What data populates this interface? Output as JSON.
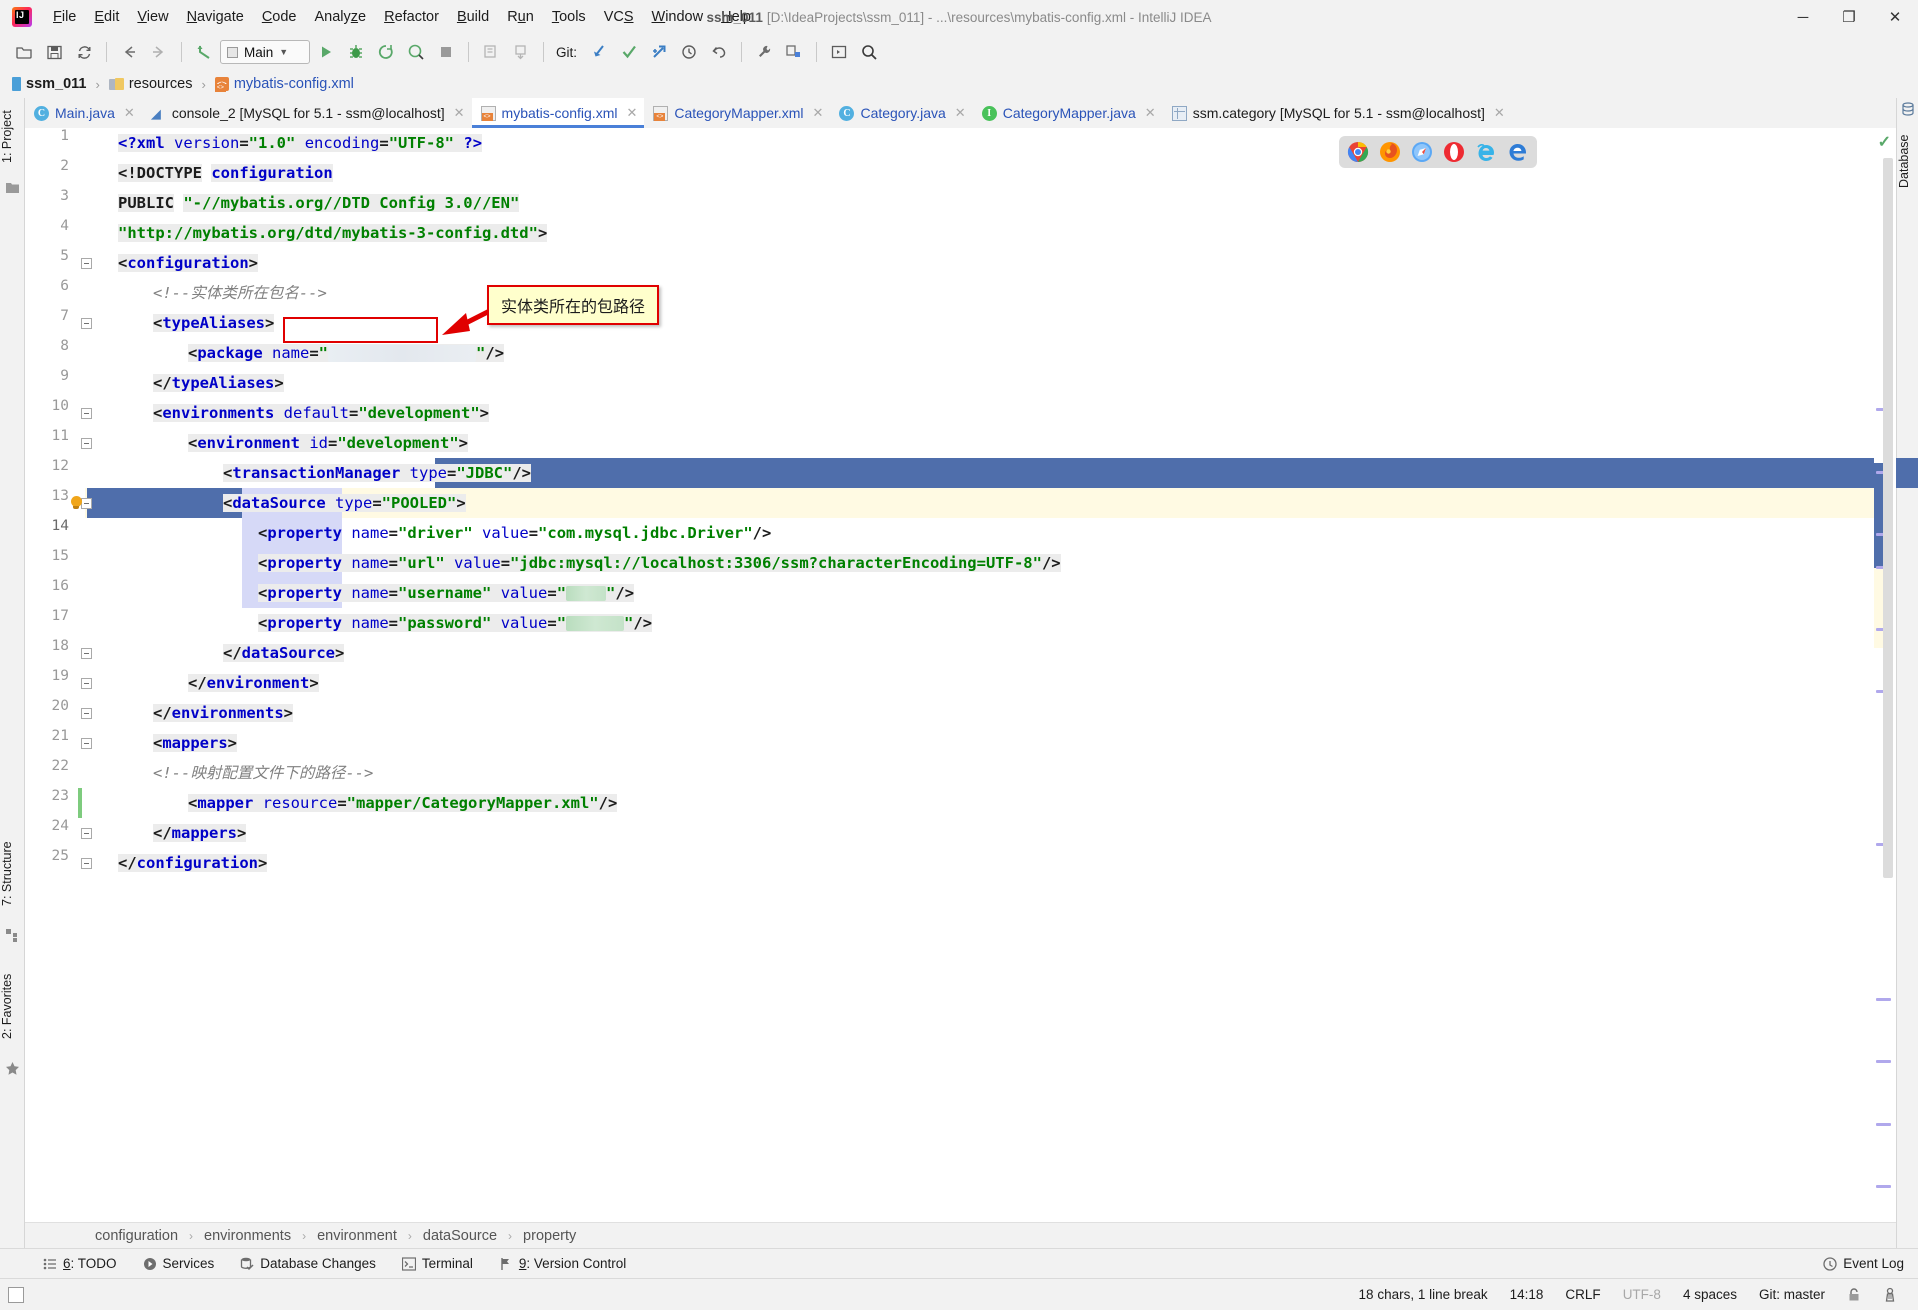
{
  "window": {
    "title_project": "ssm_011",
    "title_rest": "[D:\\IdeaProjects\\ssm_011] - ...\\resources\\mybatis-config.xml - IntelliJ IDEA",
    "minimize": "─",
    "maximize": "❐",
    "close": "✕"
  },
  "menubar": {
    "items": [
      {
        "label": "File"
      },
      {
        "label": "Edit"
      },
      {
        "label": "View"
      },
      {
        "label": "Navigate"
      },
      {
        "label": "Code"
      },
      {
        "label": "Analyze"
      },
      {
        "label": "Refactor"
      },
      {
        "label": "Build"
      },
      {
        "label": "Run"
      },
      {
        "label": "Tools"
      },
      {
        "label": "VCS"
      },
      {
        "label": "Window"
      },
      {
        "label": "Help"
      }
    ]
  },
  "toolbar": {
    "run_config": "Main",
    "git_label": "Git:",
    "icons": [
      "open-project-icon",
      "save-all-icon",
      "sync-refresh-icon",
      "back-arrow-icon",
      "forward-arrow-icon",
      "undo-jump-icon",
      "run-icon",
      "debug-icon",
      "run-coverage-icon",
      "profile-icon",
      "stop-icon",
      "build-project-icon",
      "build-module-icon",
      "git-update-icon",
      "git-commit-icon",
      "git-push-icon",
      "git-history-icon",
      "git-revert-icon",
      "settings-wrench-icon",
      "project-structure-icon",
      "run-anything-icon",
      "search-everywhere-icon"
    ]
  },
  "navbar": {
    "items": [
      {
        "label": "ssm_011",
        "icon": "module-icon",
        "kind": "proj"
      },
      {
        "label": "resources",
        "icon": "resources-folder-icon",
        "kind": "folder"
      },
      {
        "label": "mybatis-config.xml",
        "icon": "xml-file-icon",
        "kind": "file"
      }
    ],
    "separator": "›"
  },
  "left_stripe": {
    "tabs": [
      {
        "label": "1: Project",
        "icon": "project-folder-icon"
      },
      {
        "label": "7: Structure",
        "icon": "structure-icon"
      },
      {
        "label": "2: Favorites",
        "icon": "star-icon"
      }
    ]
  },
  "right_stripe": {
    "tabs": [
      {
        "label": "Database",
        "icon": "database-icon"
      }
    ]
  },
  "editor_tabs": [
    {
      "label": "Main.java",
      "icon": "java-class-icon",
      "active": false,
      "close": "✕"
    },
    {
      "label": "console_2 [MySQL for 5.1 - ssm@localhost]",
      "icon": "console-icon",
      "active": false,
      "close": "✕"
    },
    {
      "label": "mybatis-config.xml",
      "icon": "xml-file-icon",
      "active": true,
      "close": "✕"
    },
    {
      "label": "CategoryMapper.xml",
      "icon": "xml-file-icon",
      "active": false,
      "close": "✕"
    },
    {
      "label": "Category.java",
      "icon": "java-class-icon",
      "active": false,
      "close": "✕"
    },
    {
      "label": "CategoryMapper.java",
      "icon": "java-interface-icon",
      "active": false,
      "close": "✕"
    },
    {
      "label": "ssm.category [MySQL for 5.1 - ssm@localhost]",
      "icon": "db-table-icon",
      "active": false,
      "close": "✕"
    }
  ],
  "editor": {
    "line_numbers": [
      "1",
      "2",
      "3",
      "4",
      "5",
      "6",
      "7",
      "8",
      "9",
      "10",
      "11",
      "12",
      "13",
      "14",
      "15",
      "16",
      "17",
      "18",
      "19",
      "20",
      "21",
      "22",
      "23",
      "24",
      "25"
    ],
    "lines": [
      {
        "n": 1,
        "indent": 0,
        "html": "<span class=\"hl-id\"><span class=\"tk-pi\">&lt;?</span><span class=\"tk-tag\">xml </span><span class=\"tk-attr\">version</span><span class=\"tk-punc\">=</span><span class=\"tk-val\">\"1.0\"</span><span class=\"tk-punc\"> </span><span class=\"tk-attr\">encoding</span><span class=\"tk-punc\">=</span><span class=\"tk-val\">\"UTF-8\"</span><span class=\"tk-punc\"> </span><span class=\"tk-pi\">?&gt;</span></span>"
      },
      {
        "n": 2,
        "indent": 0,
        "html": "<span class=\"hl-id\"><span class=\"tk-dtd\">&lt;!DOCTYPE</span></span> <span class=\"hl-id\"><span class=\"tk-tag\">configuration</span></span>"
      },
      {
        "n": 3,
        "indent": 0,
        "html": "<span class=\"hl-id\"><span class=\"tk-dtd\">PUBLIC</span></span> <span class=\"hl-id\"><span class=\"tk-val\">\"-//mybatis.org//DTD Config 3.0//EN\"</span></span>"
      },
      {
        "n": 4,
        "indent": 0,
        "html": "<span class=\"hl-id\"><span class=\"tk-val\">\"http://mybatis.org/dtd/mybatis-3-config.dtd\"</span><span class=\"tk-punc\">&gt;</span></span>"
      },
      {
        "n": 5,
        "indent": 0,
        "html": "<span class=\"hl-id\"><span class=\"tk-punc\">&lt;</span><span class=\"tk-tag\">configuration</span><span class=\"tk-punc\">&gt;</span></span>"
      },
      {
        "n": 6,
        "indent": 1,
        "html": "<span class=\"tk-cmt\">&lt;!--实体类所在包名--&gt;</span>"
      },
      {
        "n": 7,
        "indent": 1,
        "html": "<span class=\"hl-id\"><span class=\"tk-punc\">&lt;</span><span class=\"tk-tag\">typeAliases</span><span class=\"tk-punc\">&gt;</span></span>"
      },
      {
        "n": 8,
        "indent": 2,
        "html": "<span class=\"hl-id\"><span class=\"tk-punc\">&lt;</span><span class=\"tk-tag\">package </span><span class=\"tk-attr\">name</span><span class=\"tk-punc\">=</span><span class=\"tk-val\">\"</span><span class=\"redacted\" style=\"width:148px;height:17px;background:linear-gradient(90deg,#e9eef3,#e3e8ee,#eaeef2)\"></span><span class=\"tk-val\">\"</span><span class=\"tk-punc\">/&gt;</span></span>"
      },
      {
        "n": 9,
        "indent": 1,
        "html": "<span class=\"hl-id\"><span class=\"tk-punc\">&lt;/</span><span class=\"tk-tag\">typeAliases</span><span class=\"tk-punc\">&gt;</span></span>"
      },
      {
        "n": 10,
        "indent": 1,
        "html": "<span class=\"hl-id\"><span class=\"tk-punc\">&lt;</span><span class=\"tk-tag\">environments </span><span class=\"tk-attr\">default</span><span class=\"tk-punc\">=</span><span class=\"tk-val\">\"development\"</span><span class=\"tk-punc\">&gt;</span></span>"
      },
      {
        "n": 11,
        "indent": 2,
        "html": "<span class=\"hl-id\"><span class=\"tk-punc\">&lt;</span><span class=\"tk-tag\">environment </span><span class=\"tk-attr\">id</span><span class=\"tk-punc\">=</span><span class=\"tk-val\">\"development\"</span><span class=\"tk-punc\">&gt;</span></span>"
      },
      {
        "n": 12,
        "indent": 3,
        "html": "<span class=\"hl-id\"><span class=\"tk-punc\">&lt;</span><span class=\"tk-tag\">transactionManager </span><span class=\"tk-attr\">type</span><span class=\"tk-punc\">=</span><span class=\"tk-val\">\"JDBC\"</span><span class=\"tk-punc\">/&gt;</span></span>"
      },
      {
        "n": 13,
        "indent": 3,
        "html": "<span class=\"hl-id\"><span class=\"tk-punc\">&lt;</span><span class=\"tk-tag\">dataSource </span><span class=\"tk-attr\">type</span><span class=\"tk-punc\">=</span><span class=\"tk-val\">\"POOLED\"</span><span class=\"tk-punc\">&gt;</span></span>"
      },
      {
        "n": 14,
        "indent": 4,
        "html": "<span class=\"tk-punc\">&lt;</span><span class=\"tk-tag\">property </span><span class=\"tk-attr\">name</span><span class=\"tk-punc\">=</span><span class=\"tk-val\">\"driver\"</span><span class=\"tk-punc\"> </span><span class=\"tk-attr\">value</span><span class=\"tk-punc\">=</span><span class=\"tk-val\">\"com.mysql.jdbc.Driver\"</span><span class=\"tk-punc\">/&gt;</span>"
      },
      {
        "n": 15,
        "indent": 4,
        "html": "<span class=\"hl-id\"><span class=\"tk-punc\">&lt;</span><span class=\"tk-tag\">property </span><span class=\"tk-attr\">name</span><span class=\"tk-punc\">=</span><span class=\"tk-val\">\"url\"</span><span class=\"tk-punc\"> </span><span class=\"tk-attr\">value</span><span class=\"tk-punc\">=</span><span class=\"tk-val\">\"jdbc:mysql://localhost:3306/ssm?characterEncoding=UTF-8\"</span><span class=\"tk-punc\">/&gt;</span></span>"
      },
      {
        "n": 16,
        "indent": 4,
        "html": "<span class=\"hl-id\"><span class=\"tk-punc\">&lt;</span><span class=\"tk-tag\">property </span><span class=\"tk-attr\">name</span><span class=\"tk-punc\">=</span><span class=\"tk-val\">\"username\"</span><span class=\"tk-punc\"> </span><span class=\"tk-attr\">value</span><span class=\"tk-punc\">=</span><span class=\"tk-val\">\"</span><span class=\"redacted\" style=\"width:40px;height:15px;background:linear-gradient(90deg,#b9ddbe,#cfe8d2,#c4e2c8)\"></span><span class=\"tk-val\">\"</span><span class=\"tk-punc\">/&gt;</span></span>"
      },
      {
        "n": 17,
        "indent": 4,
        "html": "<span class=\"hl-id\"><span class=\"tk-punc\">&lt;</span><span class=\"tk-tag\">property </span><span class=\"tk-attr\">name</span><span class=\"tk-punc\">=</span><span class=\"tk-val\">\"password\"</span><span class=\"tk-punc\"> </span><span class=\"tk-attr\">value</span><span class=\"tk-punc\">=</span><span class=\"tk-val\">\"</span><span class=\"redacted\" style=\"width:58px;height:15px;background:linear-gradient(90deg,#b9ddbe,#cfe8d2,#c4e2c8)\"></span><span class=\"tk-val\">\"</span><span class=\"tk-punc\">/&gt;</span></span>"
      },
      {
        "n": 18,
        "indent": 3,
        "html": "<span class=\"hl-id\"><span class=\"tk-punc\">&lt;/</span><span class=\"tk-tag\">dataSource</span><span class=\"tk-punc\">&gt;</span></span>"
      },
      {
        "n": 19,
        "indent": 2,
        "html": "<span class=\"hl-id\"><span class=\"tk-punc\">&lt;/</span><span class=\"tk-tag\">environment</span><span class=\"tk-punc\">&gt;</span></span>"
      },
      {
        "n": 20,
        "indent": 1,
        "html": "<span class=\"hl-id\"><span class=\"tk-punc\">&lt;/</span><span class=\"tk-tag\">environments</span><span class=\"tk-punc\">&gt;</span></span>"
      },
      {
        "n": 21,
        "indent": 1,
        "html": "<span class=\"hl-id\"><span class=\"tk-punc\">&lt;</span><span class=\"tk-tag\">mappers</span><span class=\"tk-punc\">&gt;</span></span>"
      },
      {
        "n": 22,
        "indent": 1,
        "html": "<span class=\"tk-cmt\">&lt;!--映射配置文件下的路径--&gt;</span>"
      },
      {
        "n": 23,
        "indent": 2,
        "html": "<span class=\"hl-id\"><span class=\"tk-punc\">&lt;</span><span class=\"tk-tag\">mapper </span><span class=\"tk-attr\">resource</span><span class=\"tk-punc\">=</span><span class=\"tk-val\">\"mapper/CategoryMapper.xml\"</span><span class=\"tk-punc\">/&gt;</span></span>"
      },
      {
        "n": 24,
        "indent": 1,
        "html": "<span class=\"hl-id\"><span class=\"tk-punc\">&lt;/</span><span class=\"tk-tag\">mappers</span><span class=\"tk-punc\">&gt;</span></span>"
      },
      {
        "n": 25,
        "indent": 0,
        "html": "<span class=\"hl-id\"><span class=\"tk-punc\">&lt;/</span><span class=\"tk-tag\">configuration</span><span class=\"tk-punc\">&gt;</span></span>"
      }
    ],
    "fold_lines": [
      5,
      7,
      10,
      11,
      13,
      18,
      19,
      20,
      21,
      24,
      25
    ],
    "current_line": 14,
    "inspection_status": "✓"
  },
  "annotation": {
    "text": "实体类所在的包路径",
    "color": "#e00000",
    "background": "#ffffcc"
  },
  "browsers": {
    "items": [
      "chrome-icon",
      "firefox-icon",
      "safari-icon",
      "opera-icon",
      "internet-explorer-icon",
      "edge-icon"
    ]
  },
  "bottom_breadcrumb": {
    "items": [
      "configuration",
      "environments",
      "environment",
      "dataSource",
      "property"
    ],
    "separator": "›"
  },
  "bottom_toolwindows": [
    {
      "key": "6",
      "label": ": TODO",
      "icon": "todo-list-icon"
    },
    {
      "key": "",
      "label": "Services",
      "icon": "services-play-icon"
    },
    {
      "key": "",
      "label": "Database Changes",
      "icon": "database-changes-icon"
    },
    {
      "key": "",
      "label": "Terminal",
      "icon": "terminal-icon"
    },
    {
      "key": "9",
      "label": ": Version Control",
      "icon": "version-control-icon"
    }
  ],
  "event_log": {
    "label": "Event Log",
    "icon": "event-log-icon"
  },
  "statusbar": {
    "selection": "18 chars, 1 line break",
    "caret": "14:18",
    "line_separator": "CRLF",
    "encoding": "UTF-8",
    "indent": "4 spaces",
    "branch": "Git: master",
    "lock_icon": "lock-icon",
    "inspect_icon": "inspection-icon"
  },
  "colors": {
    "accent": "#4a80d8",
    "selection": "#4f6eab",
    "current_line": "#fffae3",
    "tag": "#0000c8",
    "value": "#008000",
    "comment": "#808080",
    "annotation_border": "#e00000"
  }
}
